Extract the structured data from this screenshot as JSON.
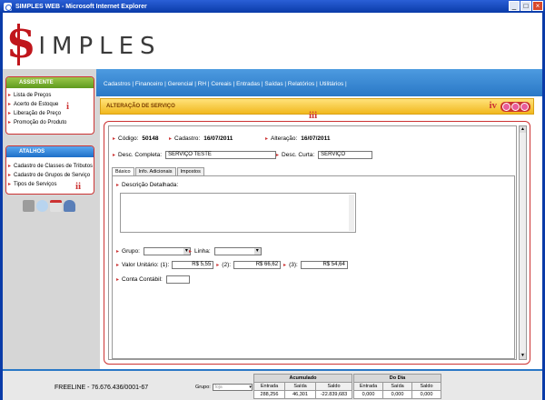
{
  "window": {
    "title": "SIMPLES WEB - Microsoft Internet Explorer"
  },
  "logo": {
    "first": "S",
    "rest": "IMPLES"
  },
  "sidebar": {
    "assistente": {
      "title": "ASSISTENTE",
      "marker": "i",
      "items": [
        "Lista de Preços",
        "Acerto de Estoque",
        "Liberação de Preço",
        "Promoção do Produto"
      ]
    },
    "atalhos": {
      "title": "ATALHOS",
      "marker": "ii",
      "items": [
        "Cadastro de Classes de Tributos",
        "Cadastro de Grupos de Serviço",
        "Tipos de Serviços"
      ]
    }
  },
  "nav": {
    "menu": "Cadastros | Financeiro | Gerencial | RH | Cereais | Entradas | Saídas | Relatórios | Utilitários |"
  },
  "form": {
    "title": "ALTERAÇÃO DE SERVIÇO",
    "marker_body": "iii",
    "marker_header": "iv",
    "codigo_label": "Código:",
    "codigo_value": "50148",
    "cadastro_label": "Cadastro:",
    "cadastro_value": "16/07/2011",
    "alteracao_label": "Alteração:",
    "alteracao_value": "16/07/2011",
    "desc_completa_label": "Desc. Completa:",
    "desc_completa_value": "SERVIÇO TESTE",
    "desc_curta_label": "Desc. Curta:",
    "desc_curta_value": "SERVIÇO",
    "tabs": [
      "Básico",
      "Info. Adicionais",
      "Impostos"
    ],
    "descricao_label": "Descrição Detalhada:",
    "grupo_label": "Grupo:",
    "linha_label": "Linha:",
    "valor_label": "Valor Unitário: (1):",
    "valor1": "R$ 5,55",
    "valor2_label": "(2):",
    "valor2": "R$ 66,62",
    "valor3_label": "(3):",
    "valor3": "R$ 54,64",
    "conta_label": "Conta Contábil:"
  },
  "status": {
    "company": "FREELINE - 76.676.436/0001-67",
    "grupo_label": "Grupo:",
    "grupo_placeholder": "loja",
    "acumulado": {
      "title": "Acumulado",
      "cols": [
        "Entrada",
        "Saída",
        "Saldo"
      ],
      "values": [
        "288,256",
        "46,301",
        "-22.839,683"
      ]
    },
    "dodia": {
      "title": "Do Dia",
      "cols": [
        "Entrada",
        "Saída",
        "Saldo"
      ],
      "values": [
        "0,000",
        "0,000",
        "0,000"
      ]
    }
  }
}
